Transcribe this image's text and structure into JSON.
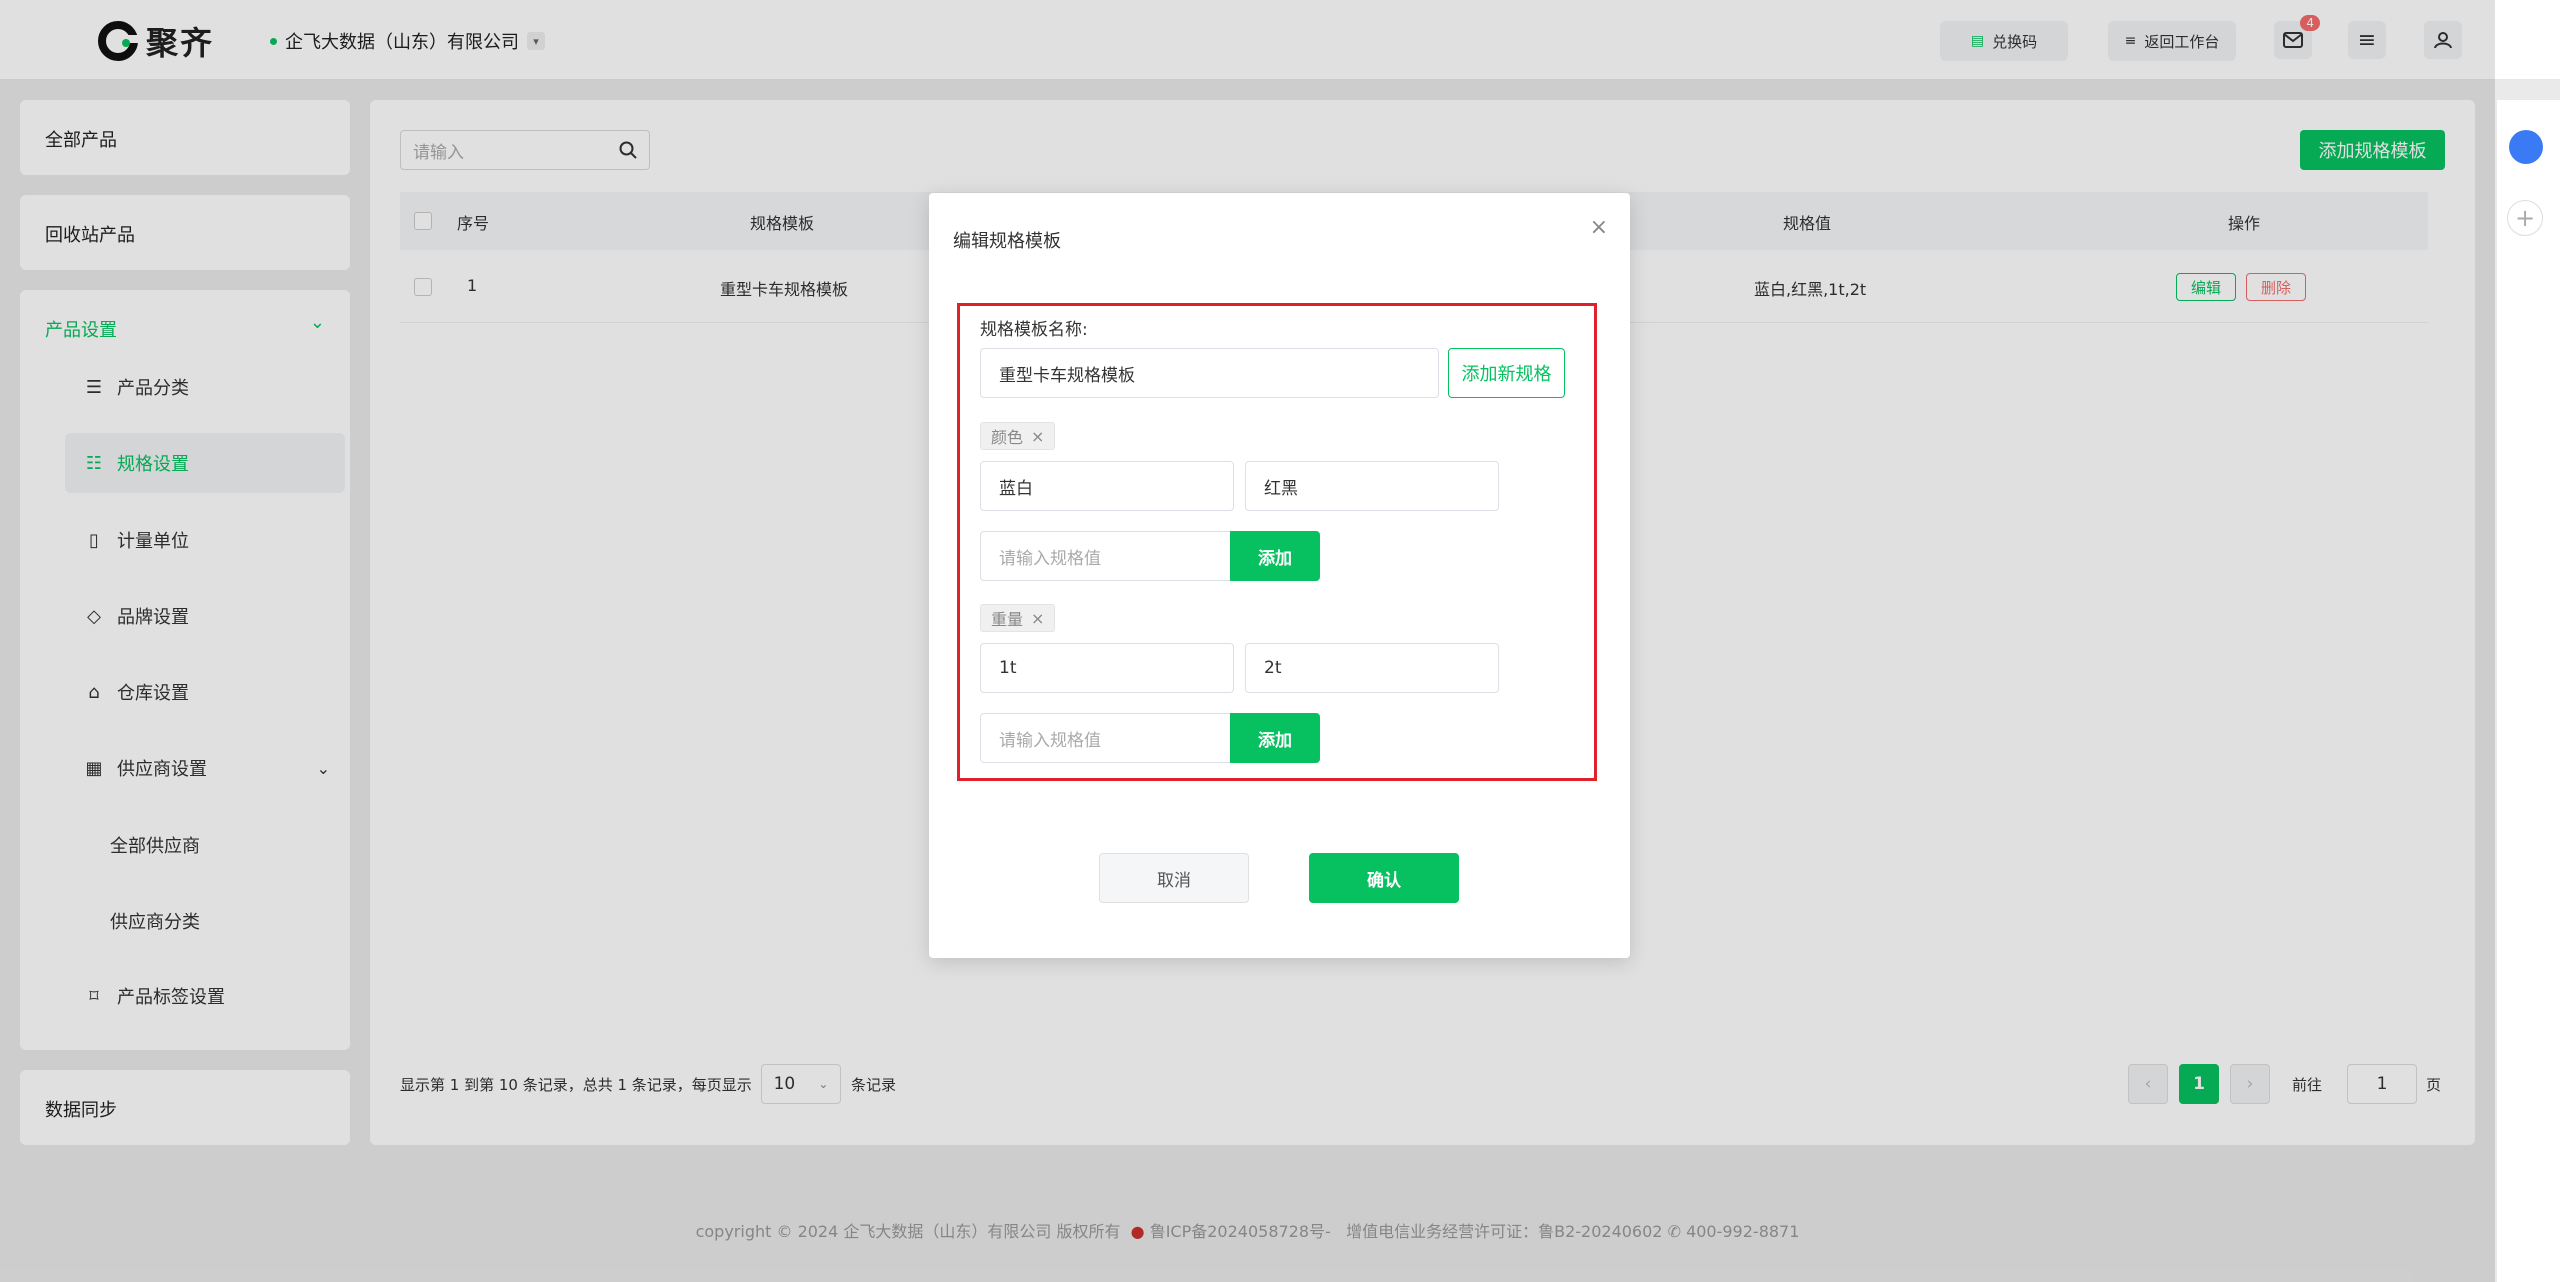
{
  "header": {
    "logo_text": "聚齐",
    "company": "企飞大数据（山东）有限公司",
    "redeem_label": "兑换码",
    "workspace_label": "返回工作台",
    "mail_badge": "4"
  },
  "sidebar": {
    "all_products": "全部产品",
    "recycle": "回收站产品",
    "product_settings": "产品设置",
    "items": [
      {
        "label": "产品分类"
      },
      {
        "label": "规格设置"
      },
      {
        "label": "计量单位"
      },
      {
        "label": "品牌设置"
      },
      {
        "label": "仓库设置"
      },
      {
        "label": "供应商设置"
      }
    ],
    "sub_items": [
      {
        "label": "全部供应商"
      },
      {
        "label": "供应商分类"
      }
    ],
    "tag_settings": "产品标签设置",
    "data_sync": "数据同步"
  },
  "main": {
    "search_placeholder": "请输入",
    "add_template_label": "添加规格模板",
    "columns": [
      "序号",
      "规格模板",
      "规格值",
      "操作"
    ],
    "rows": [
      {
        "index": "1",
        "template": "重型卡车规格模板",
        "values": "蓝白,红黑,1t,2t",
        "edit": "编辑",
        "delete": "删除"
      }
    ],
    "pager": {
      "summary": "显示第 1 到第 10 条记录，总共 1 条记录，每页显示",
      "page_size": "10",
      "unit": "条记录",
      "current_page": "1",
      "goto_label": "前往",
      "goto_value": "1",
      "page_unit": "页"
    }
  },
  "footer": {
    "text": "copyright © 2024 企飞大数据（山东）有限公司 版权所有",
    "icp": "鲁ICP备2024058728号-",
    "license": "增值电信业务经营许可证：鲁B2-20240602",
    "phone": "400-992-8871"
  },
  "dialog": {
    "title": "编辑规格模板",
    "name_label": "规格模板名称:",
    "name_value": "重型卡车规格模板",
    "add_spec_label": "添加新规格",
    "specs": [
      {
        "name": "颜色",
        "values": [
          "蓝白",
          "红黑"
        ],
        "input_placeholder": "请输入规格值",
        "add_label": "添加"
      },
      {
        "name": "重量",
        "values": [
          "1t",
          "2t"
        ],
        "input_placeholder": "请输入规格值",
        "add_label": "添加"
      }
    ],
    "cancel_label": "取消",
    "confirm_label": "确认"
  },
  "colors": {
    "accent": "#07c160",
    "danger": "#f56c6c",
    "highlight": "#e0202a"
  }
}
